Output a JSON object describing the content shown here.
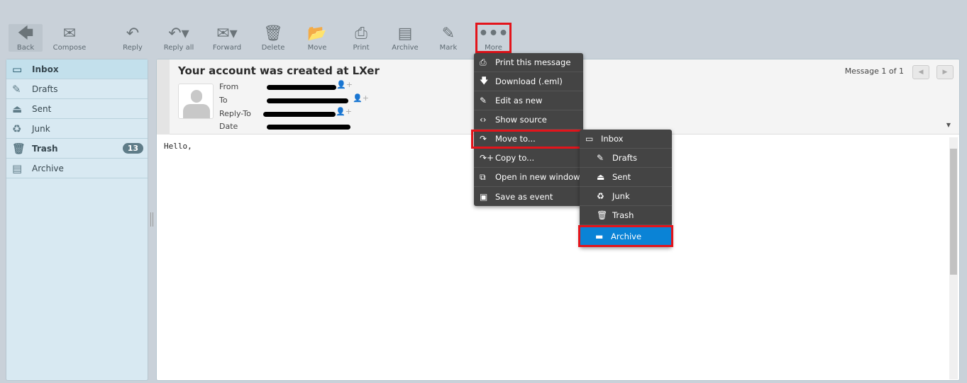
{
  "toolbar": [
    {
      "label": "Back",
      "icon": "arrow-left-icon"
    },
    {
      "label": "Compose",
      "icon": "envelope-plus-icon"
    },
    {
      "label": "Reply",
      "icon": "reply-icon"
    },
    {
      "label": "Reply all",
      "icon": "reply-all-icon"
    },
    {
      "label": "Forward",
      "icon": "forward-icon"
    },
    {
      "label": "Delete",
      "icon": "trash-icon"
    },
    {
      "label": "Move",
      "icon": "folder-move-icon"
    },
    {
      "label": "Print",
      "icon": "printer-icon"
    },
    {
      "label": "Archive",
      "icon": "archive-icon"
    },
    {
      "label": "Mark",
      "icon": "pen-icon"
    },
    {
      "label": "More",
      "icon": "ellipsis-icon"
    }
  ],
  "sidebar": {
    "items": [
      {
        "label": "Inbox"
      },
      {
        "label": "Drafts"
      },
      {
        "label": "Sent"
      },
      {
        "label": "Junk"
      },
      {
        "label": "Trash",
        "badge": "13"
      },
      {
        "label": "Archive"
      }
    ]
  },
  "message": {
    "subject": "Your account was created at LXer",
    "fields": [
      "From",
      "To",
      "Reply-To",
      "Date"
    ],
    "counter": "Message 1 of 1",
    "body": "Hello,"
  },
  "more_menu": [
    "Print this message",
    "Download (.eml)",
    "Edit as new",
    "Show source",
    "Move to...",
    "Copy to...",
    "Open in new window",
    "Save as event"
  ],
  "move_submenu": [
    "Inbox",
    "Drafts",
    "Sent",
    "Junk",
    "Trash",
    "Archive"
  ],
  "colors": {
    "highlight": "#e3141b",
    "selected": "#0a83d6"
  }
}
